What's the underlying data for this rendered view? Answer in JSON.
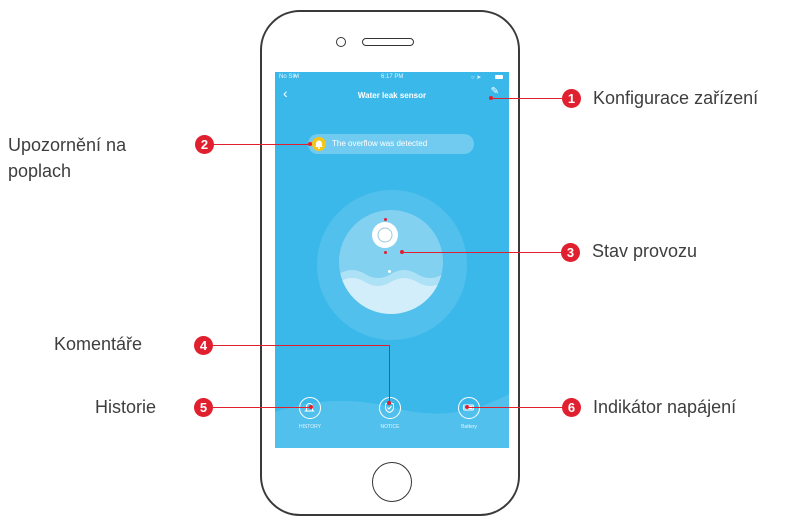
{
  "screen": {
    "status": {
      "carrier": "No SIM",
      "time": "6:17 PM"
    },
    "nav": {
      "title": "Water leak sensor",
      "back_icon": "chevron-left-icon",
      "edit_icon": "pencil-icon"
    },
    "alert": {
      "text": "The overflow was detected",
      "icon": "bell-icon"
    },
    "bottom_buttons": [
      {
        "label": "HISTORY",
        "icon": "bell-icon"
      },
      {
        "label": "NOTICE",
        "icon": "shield-icon"
      },
      {
        "label": "Battery",
        "icon": "battery-icon"
      }
    ]
  },
  "callouts": [
    {
      "number": "1",
      "label": "Konfigurace zařízení"
    },
    {
      "number": "2",
      "label": "Upozornění na poplach"
    },
    {
      "number": "3",
      "label": "Stav provozu"
    },
    {
      "number": "4",
      "label": "Komentáře"
    },
    {
      "number": "5",
      "label": "Historie"
    },
    {
      "number": "6",
      "label": "Indikátor napájení"
    }
  ],
  "colors": {
    "screen_bg": "#3bb8ea",
    "callout_red": "#e0202e",
    "bell_yellow": "#f5c518"
  }
}
